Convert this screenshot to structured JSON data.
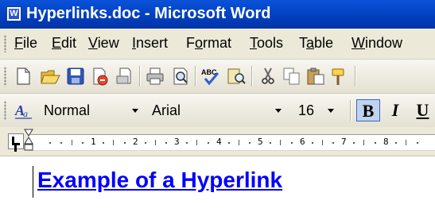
{
  "window": {
    "title": "Hyperlinks.doc - Microsoft Word"
  },
  "menubar": {
    "items": [
      {
        "label": "File",
        "accel": "F"
      },
      {
        "label": "Edit",
        "accel": "E"
      },
      {
        "label": "View",
        "accel": "V"
      },
      {
        "label": "Insert",
        "accel": "I"
      },
      {
        "label": "Format",
        "accel": "o"
      },
      {
        "label": "Tools",
        "accel": "T"
      },
      {
        "label": "Table",
        "accel": "a"
      },
      {
        "label": "Window",
        "accel": "W"
      }
    ]
  },
  "standard_toolbar": {
    "icons": [
      "new-blank-document-icon",
      "open-folder-icon",
      "save-disk-icon",
      "permission-icon",
      "print-preview-icon",
      "print-icon",
      "print-preview-magnifier-icon",
      "spelling-grammar-icon",
      "research-icon",
      "cut-icon",
      "copy-icon",
      "paste-icon",
      "format-painter-icon"
    ]
  },
  "formatting_toolbar": {
    "style_value": "Normal",
    "font_value": "Arial",
    "size_value": "16",
    "bold_label": "B",
    "italic_label": "I",
    "bold_active": true
  },
  "ruler": {
    "numbers": [
      "1",
      "2",
      "3",
      "4",
      "5",
      "6",
      "7",
      "8"
    ]
  },
  "document": {
    "hyperlink_text": "Example of a Hyperlink",
    "link_color": "#0000ff"
  },
  "colors": {
    "titlebar": "#0446c8",
    "chrome": "#ece9d8",
    "bold_active_bg": "#c1d2ee"
  }
}
